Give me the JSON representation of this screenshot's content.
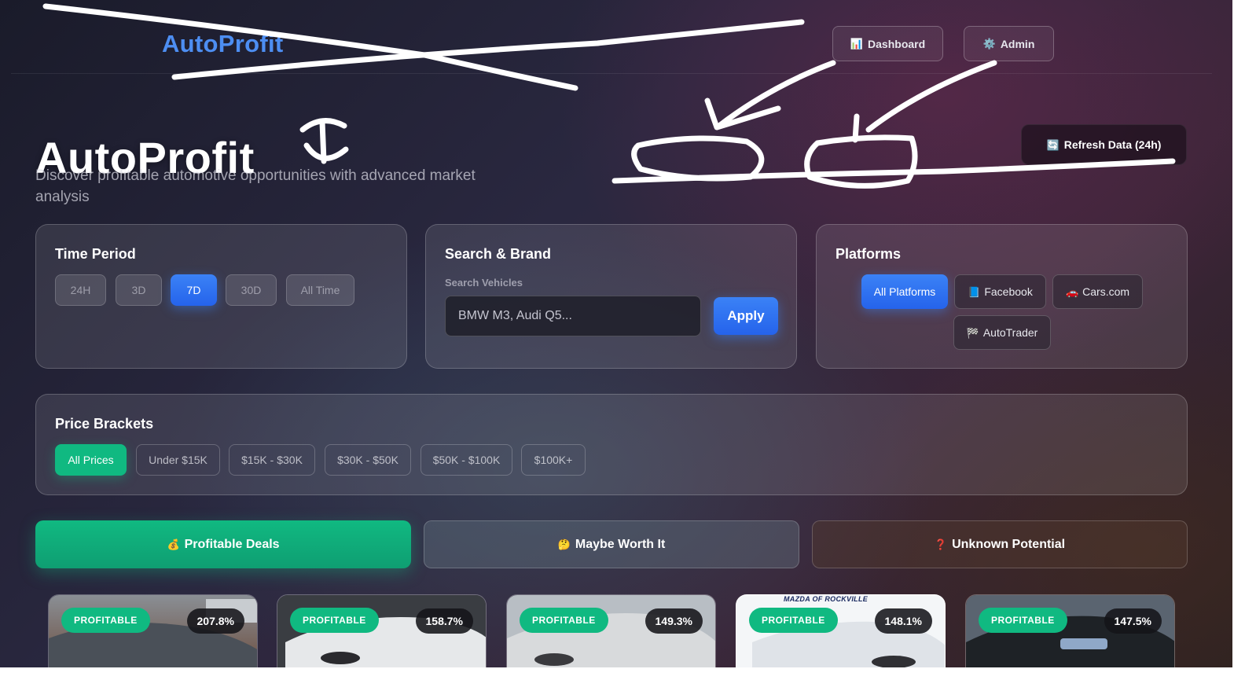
{
  "nav": {
    "logo": "AutoProfit",
    "dashboard_label": "Dashboard",
    "admin_label": "Admin",
    "dashboard_icon": "bar-chart-icon",
    "admin_icon": "gear-icon"
  },
  "hero": {
    "title": "AutoProfit",
    "subtitle": "Discover profitable automotive opportunities with advanced market analysis",
    "refresh_label": "Refresh Data (24h)",
    "refresh_icon": "refresh-icon"
  },
  "time_period": {
    "title": "Time Period",
    "options": [
      "24H",
      "3D",
      "7D",
      "30D",
      "All Time"
    ],
    "selected": "7D"
  },
  "search": {
    "title": "Search & Brand",
    "label": "Search Vehicles",
    "placeholder": "BMW M3, Audi Q5...",
    "apply_label": "Apply"
  },
  "platforms": {
    "title": "Platforms",
    "options": [
      "All Platforms",
      "Facebook",
      "Cars.com",
      "AutoTrader"
    ],
    "selected": "All Platforms"
  },
  "price_brackets": {
    "title": "Price Brackets",
    "options": [
      "All Prices",
      "Under $15K",
      "$15K - $30K",
      "$30K - $50K",
      "$50K - $100K",
      "$100K+"
    ],
    "selected": "All Prices"
  },
  "tabs": [
    {
      "label": "Profitable Deals",
      "icon": "💰"
    },
    {
      "label": "Maybe Worth It",
      "icon": "🤔"
    },
    {
      "label": "Unknown Potential",
      "icon": "❓"
    }
  ],
  "cards": [
    {
      "badge": "PROFITABLE",
      "percent": "207.8%"
    },
    {
      "badge": "PROFITABLE",
      "percent": "158.7%"
    },
    {
      "badge": "PROFITABLE",
      "percent": "149.3%"
    },
    {
      "badge": "PROFITABLE",
      "percent": "148.1%",
      "dealer_text": "MAZDA OF ROCKVILLE"
    },
    {
      "badge": "PROFITABLE",
      "percent": "147.5%"
    }
  ],
  "colors": {
    "accent_blue": "#3b82f6",
    "accent_green": "#10b981",
    "logo_blue": "#4d8ef2"
  }
}
